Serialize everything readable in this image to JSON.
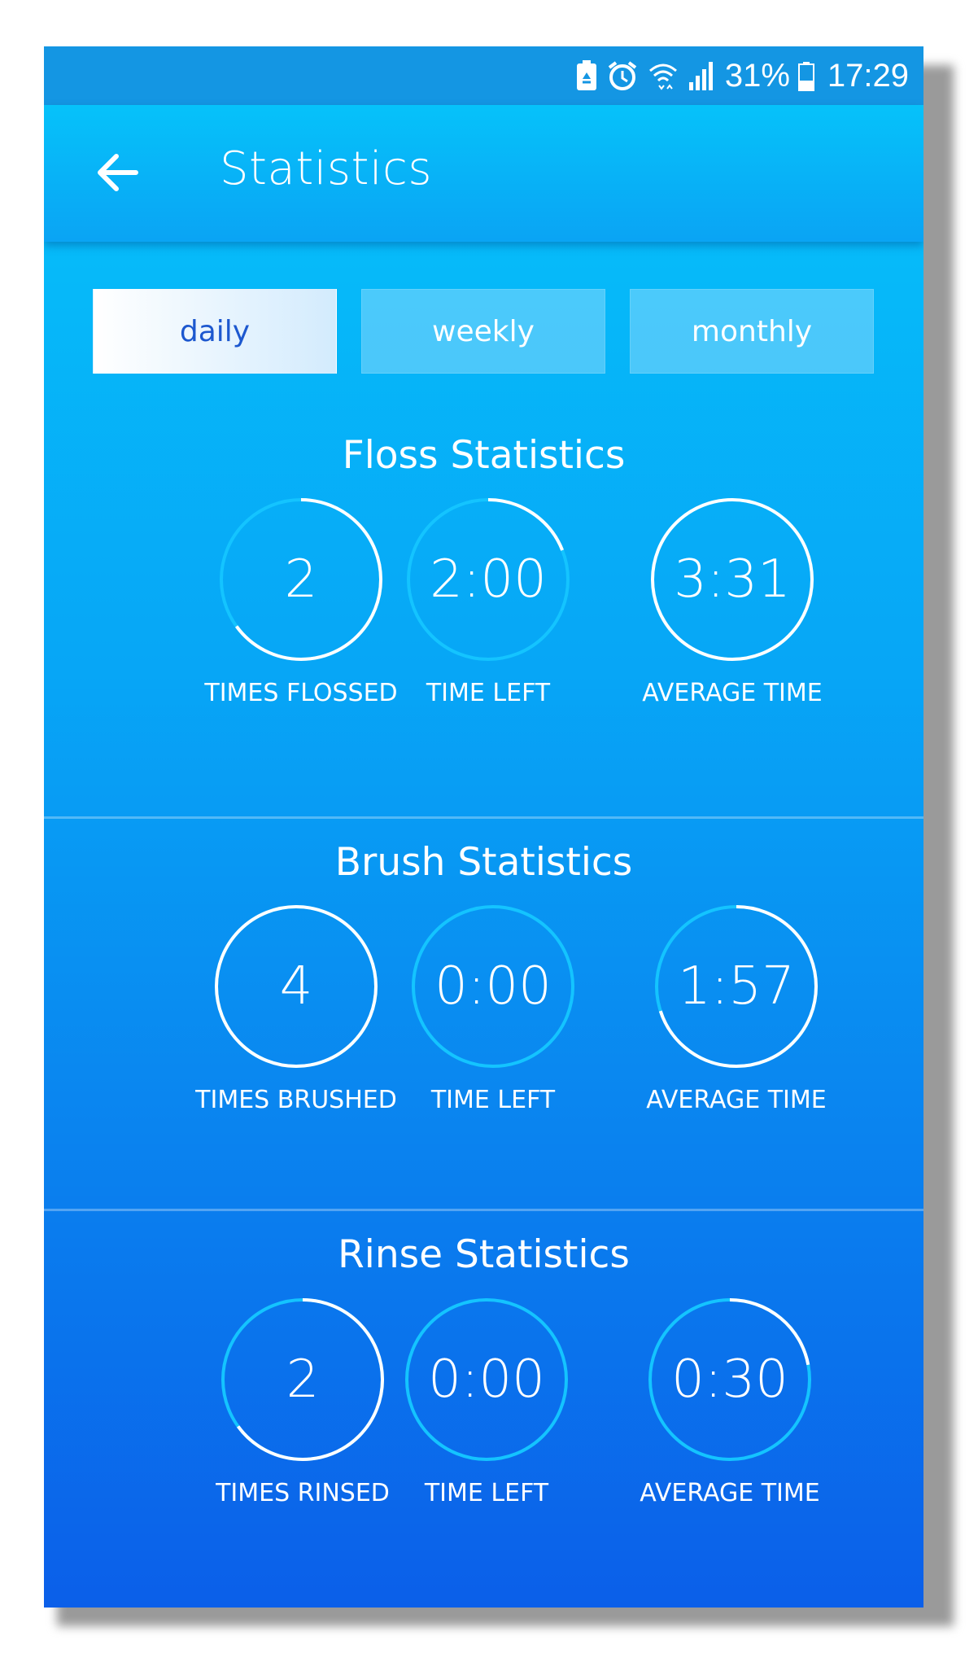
{
  "status_bar": {
    "battery_percent": "31%",
    "time": "17:29",
    "icons": [
      "battery-saver-icon",
      "alarm-icon",
      "wifi-icon",
      "signal-icon",
      "battery-icon"
    ]
  },
  "app_bar": {
    "title": "Statistics",
    "back_icon": "arrow-left-icon"
  },
  "tabs": [
    {
      "label": "daily",
      "active": true
    },
    {
      "label": "weekly",
      "active": false
    },
    {
      "label": "monthly",
      "active": false
    }
  ],
  "colors": {
    "ring_track": "#14c4ff",
    "ring_progress": "#ffffff",
    "active_tab_text": "#1d58cf"
  },
  "sections": [
    {
      "title": "Floss Statistics",
      "stats": [
        {
          "value": "2",
          "label": "TIMES FLOSSED",
          "progress": 0.65
        },
        {
          "value": "2:00",
          "label": "TIME LEFT",
          "progress": 0.19
        },
        {
          "value": "3:31",
          "label": "AVERAGE TIME",
          "progress": 1.0
        }
      ]
    },
    {
      "title": "Brush Statistics",
      "stats": [
        {
          "value": "4",
          "label": "TIMES BRUSHED",
          "progress": 1.0
        },
        {
          "value": "0:00",
          "label": "TIME LEFT",
          "progress": 0.0
        },
        {
          "value": "1:57",
          "label": "AVERAGE TIME",
          "progress": 0.7
        }
      ]
    },
    {
      "title": "Rinse Statistics",
      "stats": [
        {
          "value": "2",
          "label": "TIMES RINSED",
          "progress": 0.65
        },
        {
          "value": "0:00",
          "label": "TIME LEFT",
          "progress": 0.0
        },
        {
          "value": "0:30",
          "label": "AVERAGE TIME",
          "progress": 0.22
        }
      ]
    }
  ]
}
